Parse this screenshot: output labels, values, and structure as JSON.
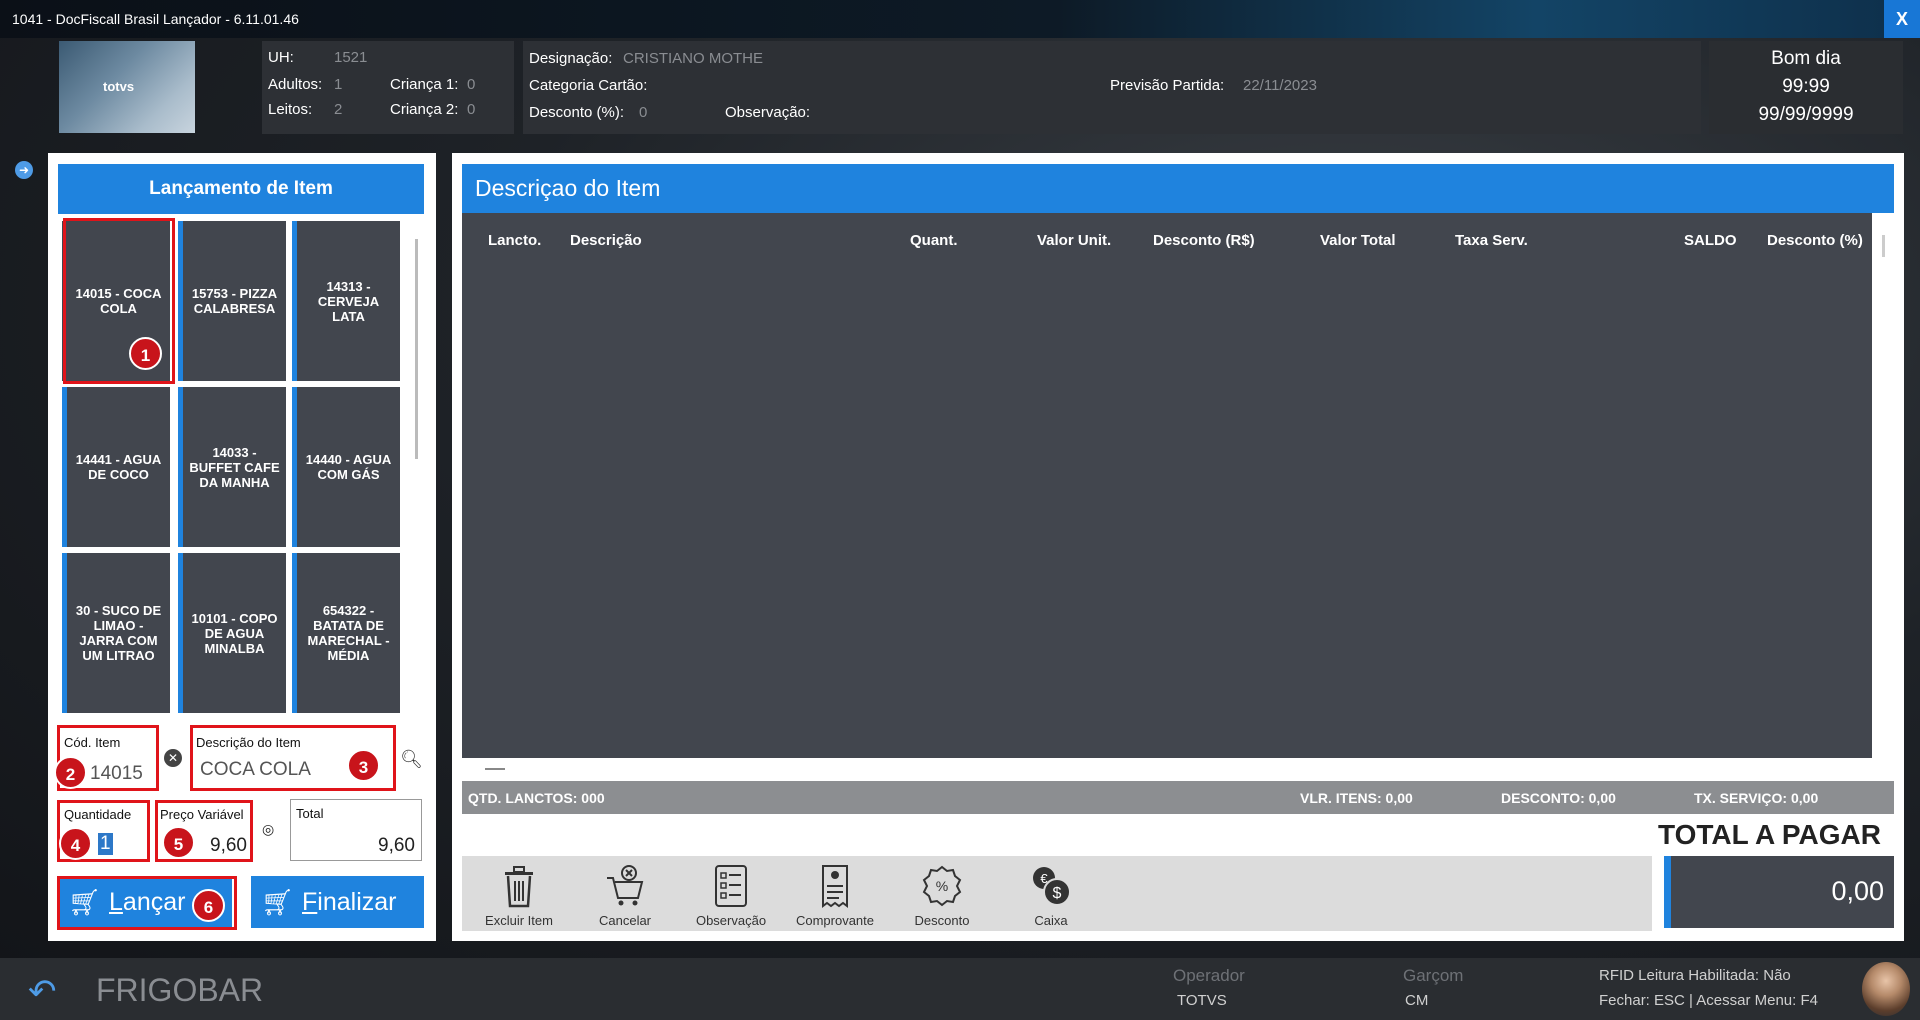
{
  "window": {
    "title": "1041 - DocFiscall Brasil Lançador - 6.11.01.46",
    "close_label": "X"
  },
  "logo": {
    "brand": "totvs"
  },
  "guest": {
    "uh_label": "UH:",
    "uh_value": "1521",
    "adultos_label": "Adultos:",
    "adultos_value": "1",
    "leitos_label": "Leitos:",
    "leitos_value": "2",
    "crianca1_label": "Criança 1:",
    "crianca1_value": "0",
    "crianca2_label": "Criança 2:",
    "crianca2_value": "0"
  },
  "reservation": {
    "designacao_label": "Designação:",
    "designacao_value": "CRISTIANO MOTHE",
    "categoria_label": "Categoria Cartão:",
    "desconto_label": "Desconto (%):",
    "desconto_value": "0",
    "observacao_label": "Observação:",
    "previsao_label": "Previsão Partida:",
    "previsao_value": "22/11/2023"
  },
  "greeting": {
    "text": "Bom dia",
    "time": "99:99",
    "date": "99/99/9999"
  },
  "item_panel": {
    "title": "Lançamento de Item",
    "tiles": [
      "14015 - COCA COLA",
      "15753 - PIZZA CALABRESA",
      "14313 - CERVEJA LATA",
      "14441 - AGUA DE COCO",
      "14033 - BUFFET CAFE DA MANHA",
      "14440 - AGUA COM GÁS",
      "30 - SUCO DE LIMAO - JARRA COM UM LITRAO",
      "10101 - COPO DE AGUA MINALBA",
      "654322 - BATATA DE MARECHAL - MÉDIA"
    ],
    "cod_label": "Cód. Item",
    "cod_value": "14015",
    "desc_label": "Descrição do Item",
    "desc_value": "COCA COLA",
    "qtd_label": "Quantidade",
    "qtd_value": "1",
    "preco_label": "Preço Variável",
    "preco_value": "9,60",
    "total_label": "Total",
    "total_value": "9,60",
    "lancar_first": "L",
    "lancar_rest": "ançar",
    "finalizar_first": "F",
    "finalizar_rest": "inalizar"
  },
  "badges": [
    "1",
    "2",
    "3",
    "4",
    "5",
    "6"
  ],
  "detail_panel": {
    "title": "Descriçao do Item",
    "columns": [
      "Lancto.",
      "Descrição",
      "Quant.",
      "Valor Unit.",
      "Desconto (R$)",
      "Valor Total",
      "Taxa Serv.",
      "SALDO",
      "Desconto (%)"
    ],
    "qtd_lanctos": "QTD. LANCTOS:  000",
    "vlr_itens": "VLR. ITENS:  0,00",
    "desconto": "DESCONTO:  0,00",
    "tx_servico": "TX. SERVIÇO:  0,00",
    "total_label": "TOTAL A PAGAR",
    "total_value": "0,00"
  },
  "actions": [
    {
      "label": "Excluir Item",
      "icon": "trash-icon"
    },
    {
      "label": "Cancelar",
      "icon": "cart-cancel-icon"
    },
    {
      "label": "Observação",
      "icon": "checklist-icon"
    },
    {
      "label": "Comprovante",
      "icon": "receipt-icon"
    },
    {
      "label": "Desconto",
      "icon": "percent-badge-icon"
    },
    {
      "label": "Caixa",
      "icon": "coins-icon"
    }
  ],
  "footer": {
    "section": "FRIGOBAR",
    "operador_label": "Operador",
    "operador_value": "TOTVS",
    "garcom_label": "Garçom",
    "garcom_value": "CM",
    "rfid": "RFID Leitura Habilitada: Não",
    "shortcuts": "Fechar: ESC | Acessar Menu: F4"
  },
  "colors": {
    "accent": "#1f83de",
    "highlight": "#e0141a",
    "tile": "#42464e"
  }
}
